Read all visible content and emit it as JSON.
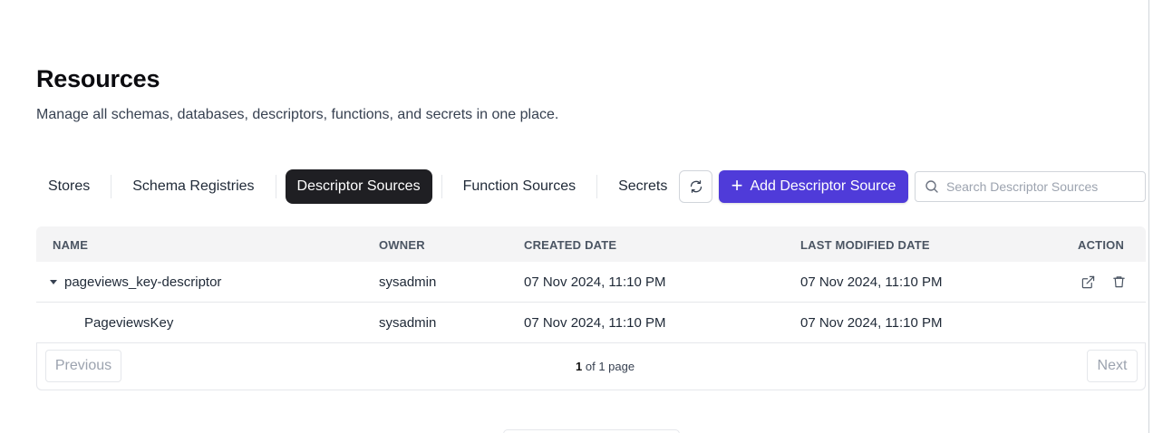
{
  "header": {
    "title": "Resources",
    "subtitle": "Manage all schemas, databases, descriptors, functions, and secrets in one place."
  },
  "tabs": [
    {
      "label": "Stores",
      "active": false
    },
    {
      "label": "Schema Registries",
      "active": false
    },
    {
      "label": "Descriptor Sources",
      "active": true
    },
    {
      "label": "Function Sources",
      "active": false
    },
    {
      "label": "Secrets",
      "active": false
    }
  ],
  "toolbar": {
    "refresh_icon": "refresh-icon",
    "add_label": "Add Descriptor Source",
    "search_placeholder": "Search Descriptor Sources"
  },
  "table": {
    "columns": [
      "NAME",
      "OWNER",
      "CREATED DATE",
      "LAST MODIFIED DATE",
      "ACTION"
    ],
    "rows": [
      {
        "name": "pageviews_key-descriptor",
        "owner": "sysadmin",
        "created": "07 Nov 2024, 11:10 PM",
        "modified": "07 Nov 2024, 11:10 PM",
        "expanded": true
      },
      {
        "name": "PageviewsKey",
        "owner": "sysadmin",
        "created": "07 Nov 2024, 11:10 PM",
        "modified": "07 Nov 2024, 11:10 PM"
      }
    ]
  },
  "pagination": {
    "previous_label": "Previous",
    "next_label": "Next",
    "current_page": "1",
    "rest": "of 1 page"
  },
  "colors": {
    "accent": "#4f3bd9",
    "active_tab_bg": "#1f1f23",
    "header_bg": "#f4f4f5"
  }
}
